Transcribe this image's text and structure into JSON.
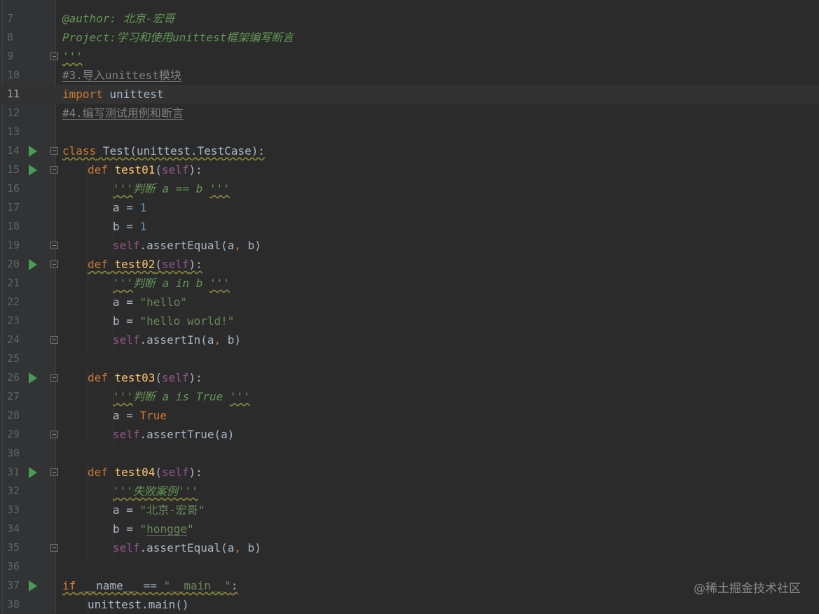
{
  "editor": {
    "language": "Python",
    "current_line": 11,
    "colors": {
      "background": "#2b2b2b",
      "gutter": "#313335",
      "keyword": "#cc7832",
      "function": "#ffc66d",
      "self": "#94558d",
      "number": "#6897bb",
      "string": "#6a8759",
      "comment": "#808080",
      "text": "#a9b7c6",
      "run_marker": "#499c54"
    },
    "lines": [
      {
        "n": "7",
        "indent": 0,
        "tokens": [
          {
            "t": "@author: 北京-宏哥",
            "c": "doc"
          }
        ]
      },
      {
        "n": "8",
        "indent": 0,
        "tokens": [
          {
            "t": "Project:学习和使用unittest框架编写断言",
            "c": "doc"
          }
        ]
      },
      {
        "n": "9",
        "indent": 0,
        "fold": true,
        "tokens": [
          {
            "t": "'''",
            "c": "doc",
            "w": true
          }
        ]
      },
      {
        "n": "10",
        "indent": 0,
        "tokens": [
          {
            "t": "#3.导入unittest模块",
            "c": "comment",
            "u": true
          }
        ]
      },
      {
        "n": "11",
        "indent": 0,
        "current": true,
        "tokens": [
          {
            "t": "import",
            "c": "kw"
          },
          {
            "t": " unittest",
            "c": "plain"
          }
        ]
      },
      {
        "n": "12",
        "indent": 0,
        "tokens": [
          {
            "t": "#4.编写测试用例和断言",
            "c": "comment",
            "u": true
          }
        ]
      },
      {
        "n": "13",
        "indent": 0,
        "tokens": []
      },
      {
        "n": "14",
        "indent": 0,
        "run": true,
        "fold": true,
        "tokens": [
          {
            "t": "class",
            "c": "kw",
            "w": true
          },
          {
            "t": " Test(unittest.TestCase):",
            "c": "plain",
            "w": true
          }
        ]
      },
      {
        "n": "15",
        "indent": 1,
        "run": true,
        "fold": true,
        "tokens": [
          {
            "t": "def",
            "c": "kw"
          },
          {
            "t": " ",
            "c": "plain"
          },
          {
            "t": "test01",
            "c": "fn"
          },
          {
            "t": "(",
            "c": "plain"
          },
          {
            "t": "self",
            "c": "self"
          },
          {
            "t": "):",
            "c": "plain"
          }
        ]
      },
      {
        "n": "16",
        "indent": 2,
        "tokens": [
          {
            "t": "'''",
            "c": "doc",
            "w": true
          },
          {
            "t": "判断 a == b ",
            "c": "doc"
          },
          {
            "t": "'''",
            "c": "doc",
            "w": true
          }
        ]
      },
      {
        "n": "17",
        "indent": 2,
        "tokens": [
          {
            "t": "a = ",
            "c": "plain"
          },
          {
            "t": "1",
            "c": "num"
          }
        ]
      },
      {
        "n": "18",
        "indent": 2,
        "tokens": [
          {
            "t": "b = ",
            "c": "plain"
          },
          {
            "t": "1",
            "c": "num"
          }
        ]
      },
      {
        "n": "19",
        "indent": 2,
        "fold": true,
        "tokens": [
          {
            "t": "self",
            "c": "self"
          },
          {
            "t": ".assertEqual(a",
            "c": "plain"
          },
          {
            "t": ",",
            "c": "kw"
          },
          {
            "t": " b)",
            "c": "plain"
          }
        ]
      },
      {
        "n": "20",
        "indent": 1,
        "run": true,
        "fold": true,
        "tokens": [
          {
            "t": "def",
            "c": "kw",
            "w": true
          },
          {
            "t": " ",
            "c": "plain",
            "w": true
          },
          {
            "t": "test02",
            "c": "fn",
            "w": true
          },
          {
            "t": "(",
            "c": "plain",
            "w": true
          },
          {
            "t": "self",
            "c": "self",
            "w": true
          },
          {
            "t": "):",
            "c": "plain",
            "w": true
          }
        ]
      },
      {
        "n": "21",
        "indent": 2,
        "tokens": [
          {
            "t": "'''",
            "c": "doc",
            "w": true
          },
          {
            "t": "判断 a in b ",
            "c": "doc"
          },
          {
            "t": "'''",
            "c": "doc",
            "w": true
          }
        ]
      },
      {
        "n": "22",
        "indent": 2,
        "tokens": [
          {
            "t": "a = ",
            "c": "plain"
          },
          {
            "t": "\"hello\"",
            "c": "str"
          }
        ]
      },
      {
        "n": "23",
        "indent": 2,
        "tokens": [
          {
            "t": "b = ",
            "c": "plain"
          },
          {
            "t": "\"hello world!\"",
            "c": "str"
          }
        ]
      },
      {
        "n": "24",
        "indent": 2,
        "fold": true,
        "tokens": [
          {
            "t": "self",
            "c": "self"
          },
          {
            "t": ".assertIn(a",
            "c": "plain"
          },
          {
            "t": ",",
            "c": "kw"
          },
          {
            "t": " b)",
            "c": "plain"
          }
        ]
      },
      {
        "n": "25",
        "indent": 0,
        "tokens": []
      },
      {
        "n": "26",
        "indent": 1,
        "run": true,
        "fold": true,
        "tokens": [
          {
            "t": "def",
            "c": "kw"
          },
          {
            "t": " ",
            "c": "plain"
          },
          {
            "t": "test03",
            "c": "fn"
          },
          {
            "t": "(",
            "c": "plain"
          },
          {
            "t": "self",
            "c": "self"
          },
          {
            "t": "):",
            "c": "plain"
          }
        ]
      },
      {
        "n": "27",
        "indent": 2,
        "tokens": [
          {
            "t": "'''",
            "c": "doc",
            "w": true
          },
          {
            "t": "判断 a is True ",
            "c": "doc"
          },
          {
            "t": "'''",
            "c": "doc",
            "w": true
          }
        ]
      },
      {
        "n": "28",
        "indent": 2,
        "tokens": [
          {
            "t": "a = ",
            "c": "plain"
          },
          {
            "t": "True",
            "c": "kw"
          }
        ]
      },
      {
        "n": "29",
        "indent": 2,
        "fold": true,
        "tokens": [
          {
            "t": "self",
            "c": "self"
          },
          {
            "t": ".assertTrue(a)",
            "c": "plain"
          }
        ]
      },
      {
        "n": "30",
        "indent": 0,
        "tokens": []
      },
      {
        "n": "31",
        "indent": 1,
        "run": true,
        "fold": true,
        "tokens": [
          {
            "t": "def",
            "c": "kw"
          },
          {
            "t": " ",
            "c": "plain"
          },
          {
            "t": "test04",
            "c": "fn"
          },
          {
            "t": "(",
            "c": "plain"
          },
          {
            "t": "self",
            "c": "self"
          },
          {
            "t": "):",
            "c": "plain"
          }
        ]
      },
      {
        "n": "32",
        "indent": 2,
        "tokens": [
          {
            "t": "'''失败案例'''",
            "c": "doc",
            "w": true
          }
        ]
      },
      {
        "n": "33",
        "indent": 2,
        "tokens": [
          {
            "t": "a = ",
            "c": "plain"
          },
          {
            "t": "\"北京-宏哥\"",
            "c": "str"
          }
        ]
      },
      {
        "n": "34",
        "indent": 2,
        "tokens": [
          {
            "t": "b = ",
            "c": "plain"
          },
          {
            "t": "\"",
            "c": "str"
          },
          {
            "t": "hongge",
            "c": "str",
            "u": true
          },
          {
            "t": "\"",
            "c": "str"
          }
        ]
      },
      {
        "n": "35",
        "indent": 2,
        "fold": true,
        "tokens": [
          {
            "t": "self",
            "c": "self"
          },
          {
            "t": ".assertEqual(a",
            "c": "plain"
          },
          {
            "t": ",",
            "c": "kw"
          },
          {
            "t": " b)",
            "c": "plain"
          }
        ]
      },
      {
        "n": "36",
        "indent": 0,
        "tokens": []
      },
      {
        "n": "37",
        "indent": 0,
        "run": true,
        "tokens": [
          {
            "t": "if",
            "c": "kw",
            "w": true
          },
          {
            "t": " __name__ == ",
            "c": "plain",
            "w": true
          },
          {
            "t": "\"__main__\"",
            "c": "str",
            "w": true
          },
          {
            "t": ":",
            "c": "plain",
            "w": true
          }
        ]
      },
      {
        "n": "38",
        "indent": 1,
        "tokens": [
          {
            "t": "unittest.main()",
            "c": "plain"
          }
        ]
      }
    ]
  },
  "watermark": "@稀土掘金技术社区"
}
